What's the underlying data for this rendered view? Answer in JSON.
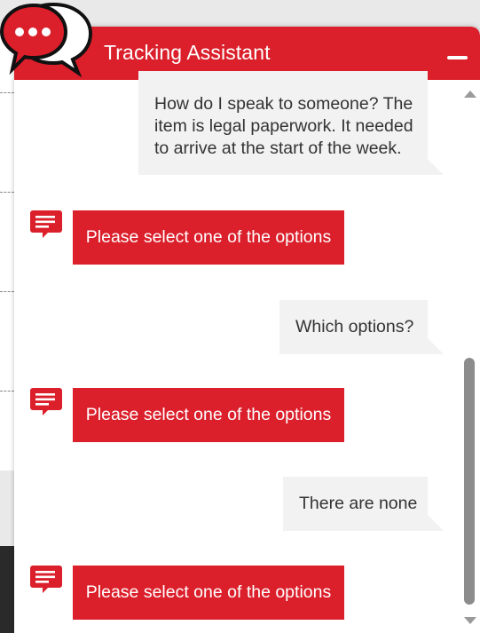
{
  "header": {
    "title": "Tracking Assistant"
  },
  "colors": {
    "brand_red": "#db1f2b",
    "bubble_grey": "#f2f2f2",
    "text_dark": "#333333"
  },
  "icons": {
    "logo": "chat-bubbles-icon",
    "bot": "chat-message-icon",
    "minimize": "minimize-icon"
  },
  "messages": [
    {
      "sender": "user",
      "lines": [
        "How do I speak to someone? The",
        "item is legal paperwork. It needed",
        "to arrive at the start of the week."
      ]
    },
    {
      "sender": "bot",
      "text": "Please select one of the options"
    },
    {
      "sender": "user",
      "text": "Which options?"
    },
    {
      "sender": "bot",
      "text": "Please select one of the options"
    },
    {
      "sender": "user",
      "text": "There are none"
    },
    {
      "sender": "bot",
      "text": "Please select one of the options"
    }
  ]
}
